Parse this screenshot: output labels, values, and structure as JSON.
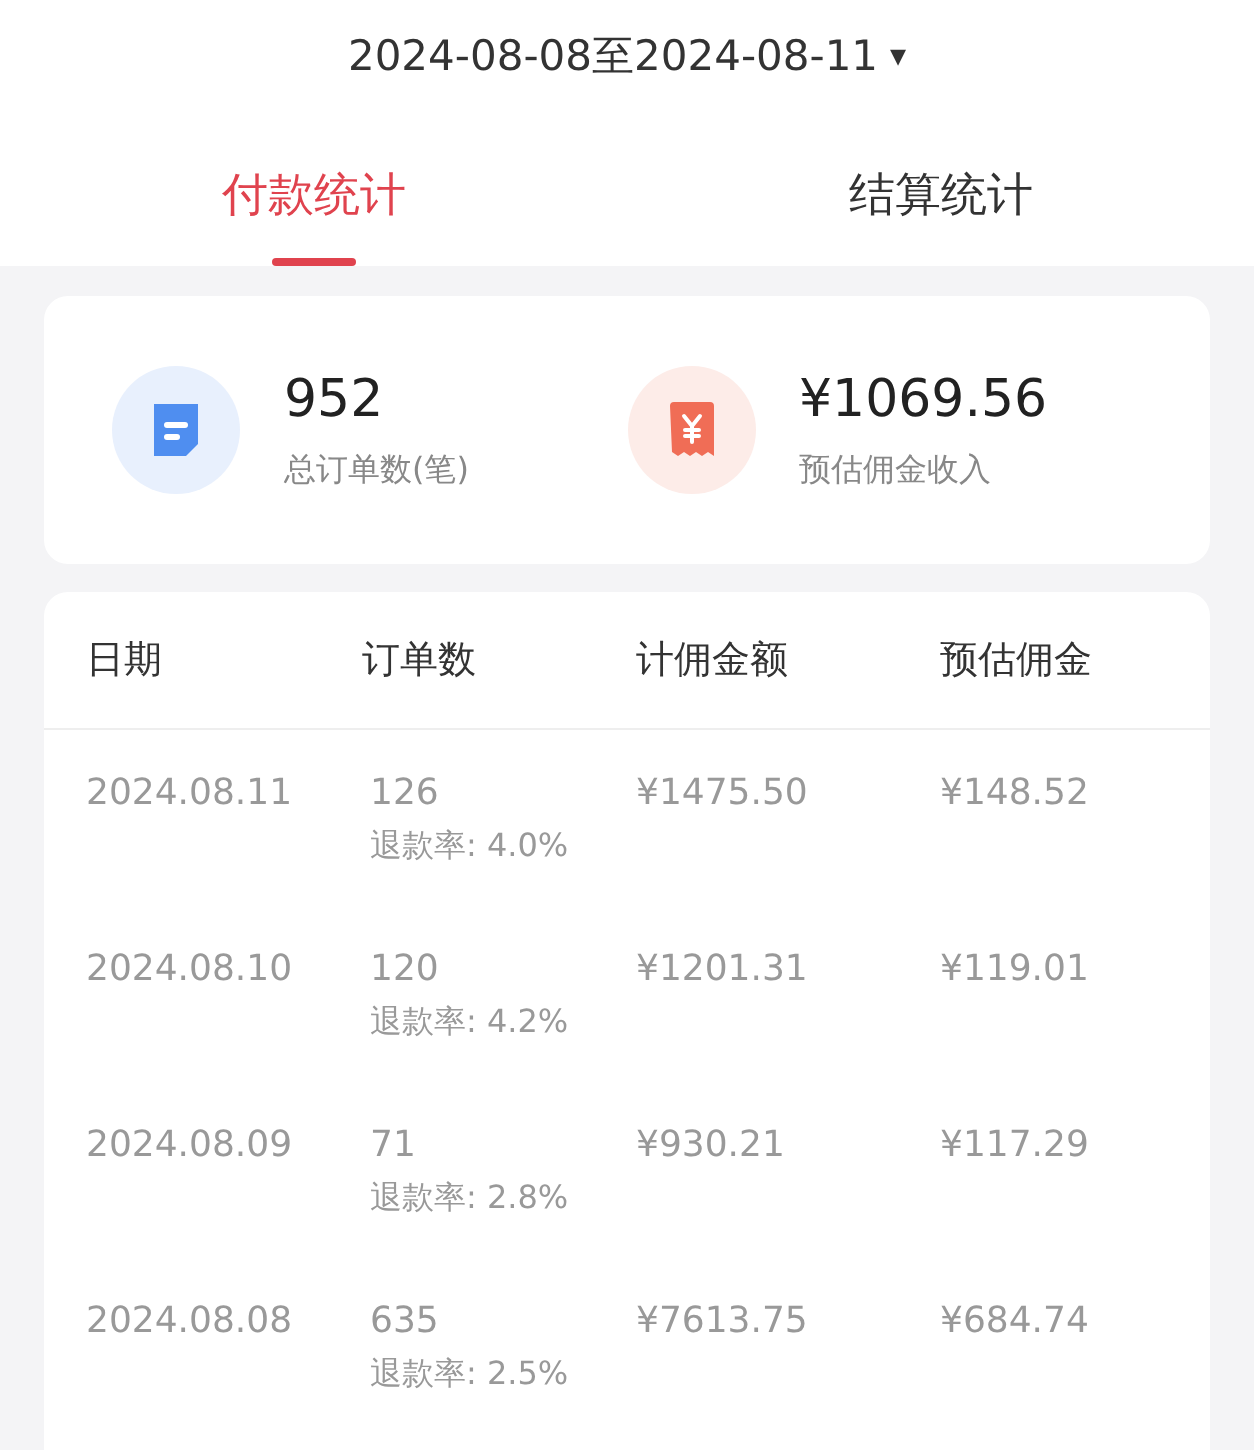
{
  "date_range": {
    "label": "2024-08-08至2024-08-11",
    "caret": "▾"
  },
  "tabs": [
    {
      "label": "付款统计",
      "selected": true
    },
    {
      "label": "结算统计",
      "selected": false
    }
  ],
  "summary": [
    {
      "kind": "orders",
      "value": "952",
      "label": "总订单数(笔)"
    },
    {
      "kind": "commission",
      "value": "¥1069.56",
      "label": "预估佣金收入"
    }
  ],
  "table": {
    "columns": [
      "日期",
      "订单数",
      "计佣金额",
      "预估佣金"
    ],
    "rows": [
      {
        "date": "2024.08.11",
        "orders": "126",
        "refund_rate": "退款率: 4.0%",
        "amount": "¥1475.50",
        "commission": "¥148.52"
      },
      {
        "date": "2024.08.10",
        "orders": "120",
        "refund_rate": "退款率: 4.2%",
        "amount": "¥1201.31",
        "commission": "¥119.01"
      },
      {
        "date": "2024.08.09",
        "orders": "71",
        "refund_rate": "退款率: 2.8%",
        "amount": "¥930.21",
        "commission": "¥117.29"
      },
      {
        "date": "2024.08.08",
        "orders": "635",
        "refund_rate": "退款率: 2.5%",
        "amount": "¥7613.75",
        "commission": "¥684.74"
      }
    ]
  }
}
